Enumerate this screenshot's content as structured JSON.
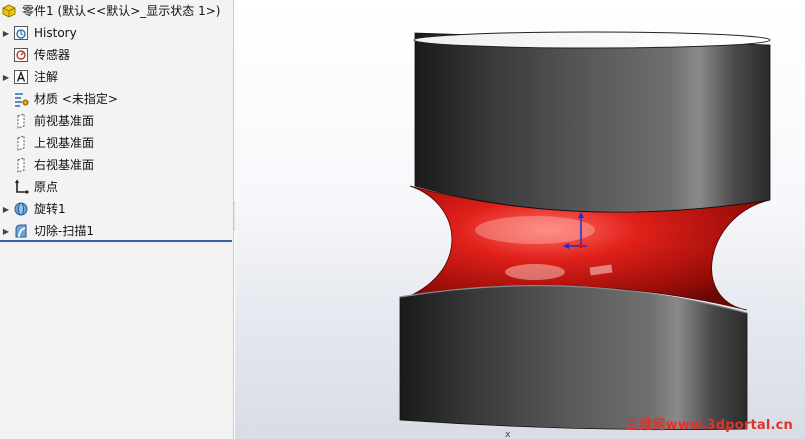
{
  "feature_tree": {
    "root_label": "零件1 (默认<<默认>_显示状态 1>)",
    "items": [
      {
        "label": "History",
        "icon": "history-icon",
        "expandable": true
      },
      {
        "label": "传感器",
        "icon": "sensor-icon",
        "expandable": false
      },
      {
        "label": "注解",
        "icon": "annotation-icon",
        "expandable": true
      },
      {
        "label": "材质 <未指定>",
        "icon": "material-icon",
        "expandable": false
      },
      {
        "label": "前视基准面",
        "icon": "plane-icon",
        "expandable": false
      },
      {
        "label": "上视基准面",
        "icon": "plane-icon",
        "expandable": false
      },
      {
        "label": "右视基准面",
        "icon": "plane-icon",
        "expandable": false
      },
      {
        "label": "原点",
        "icon": "origin-icon",
        "expandable": false
      },
      {
        "label": "旋转1",
        "icon": "revolve-icon",
        "expandable": true
      },
      {
        "label": "切除-扫描1",
        "icon": "cut-sweep-icon",
        "expandable": true
      }
    ]
  },
  "viewport": {
    "model": "revolved-part-with-swept-cut",
    "body_color": "#2b2b2b",
    "cut_face_color": "#d0140c",
    "background_top": "#ffffff",
    "background_bottom": "#d9dce4"
  },
  "watermark": "三维网www.3dportal.cn"
}
